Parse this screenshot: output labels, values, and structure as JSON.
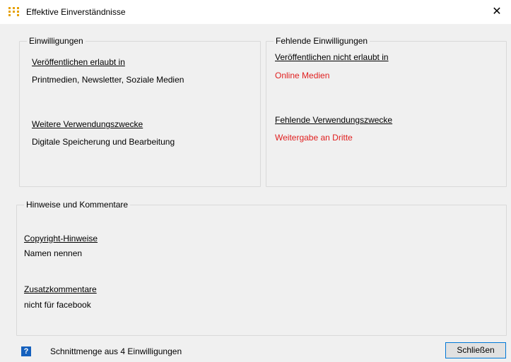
{
  "window": {
    "title": "Effektive Einverständnisse",
    "close_glyph": "✕",
    "icon": "grid-dots-icon"
  },
  "consents": {
    "legend": "Einwilligungen",
    "publish_allowed_label": "Veröffentlichen erlaubt  in",
    "publish_allowed_value": "Printmedien, Newsletter, Soziale Medien",
    "further_purposes_label": "Weitere Verwendungszwecke",
    "further_purposes_value": "Digitale Speicherung und Bearbeitung"
  },
  "missing": {
    "legend": "Fehlende Einwilligungen",
    "publish_denied_label": "Veröffentlichen nicht erlaubt in",
    "publish_denied_value": "Online Medien",
    "missing_purposes_label": "Fehlende Verwendungszwecke",
    "missing_purposes_value": "Weitergabe an Dritte",
    "value_color": "#e02020"
  },
  "notes": {
    "legend": "Hinweise und Kommentare",
    "copyright_label": "Copyright-Hinweise ",
    "copyright_value": "Namen nennen",
    "comments_label": "Zusatzkommentare",
    "comments_value": "nicht für facebook"
  },
  "footer": {
    "help_glyph": "?",
    "summary": "Schnittmenge aus 4 Einwilligungen",
    "close_button": "Schließen"
  }
}
